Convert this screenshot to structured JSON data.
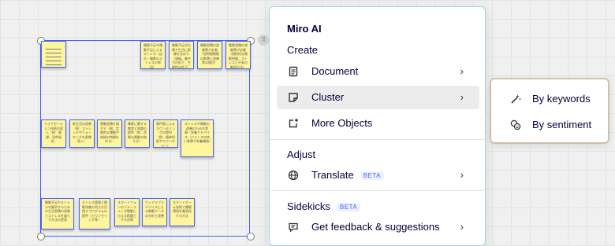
{
  "menu": {
    "title": "Miro AI",
    "create_label": "Create",
    "adjust_label": "Adjust",
    "sidekicks_label": "Sidekicks",
    "sidekicks_badge": "BETA",
    "items": {
      "document": "Document",
      "cluster": "Cluster",
      "more_objects": "More Objects",
      "translate": "Translate",
      "translate_badge": "BETA",
      "feedback": "Get feedback & suggestions"
    }
  },
  "submenu": {
    "by_keywords": "By keywords",
    "by_sentiment": "By sentiment"
  },
  "canvas": {
    "top_row": [
      "睡眠不足や運動不足によるストレス（自分・複数のストレスの原因）",
      "睡眠不足が仕事や生活に影響を及ぼす（頭痛、集中力の低下、生産性の低下）",
      "睡眠習慣の改善策が必要（短時間睡眠の影響と改善策の検討）",
      "睡眠習慣の改善策が必要（規則的な睡眠時間、ストレスと不安の解消方法）"
    ],
    "middle_row": [
      "リラクゼーション技術の導入（例：瞑想、深呼吸法）",
      "新生活の改善（例：ストレッチやウォーキングの習慣導入）",
      "運動習慣を増やす（例：定期的な運動や体操の時間を作る）",
      "睡眠に関する教育と知識の提供（例：良質な睡眠の取り方）",
      "専門家によるカウンセリングの提供（例：精神科医やカウンセラー）",
      "ストレスや睡眠の改善のための食事・栄養アドバイス（バランスの良い食事や栄養補給）"
    ],
    "bottom_row": [
      "睡眠不足やストレスを解消するための生活習慣の改善とストレスを減らす方法の提案",
      "ストレス管理と睡眠改善の両立を目指すプログラムの提供（カウンセリング等）",
      "スマートフォンのブルーライトが睡眠に与える影響とその対策",
      "ウェアラブルデバイスによる睡眠データの分析と改善",
      "スマートホーム技術で睡眠環境を最適化する方法"
    ]
  }
}
